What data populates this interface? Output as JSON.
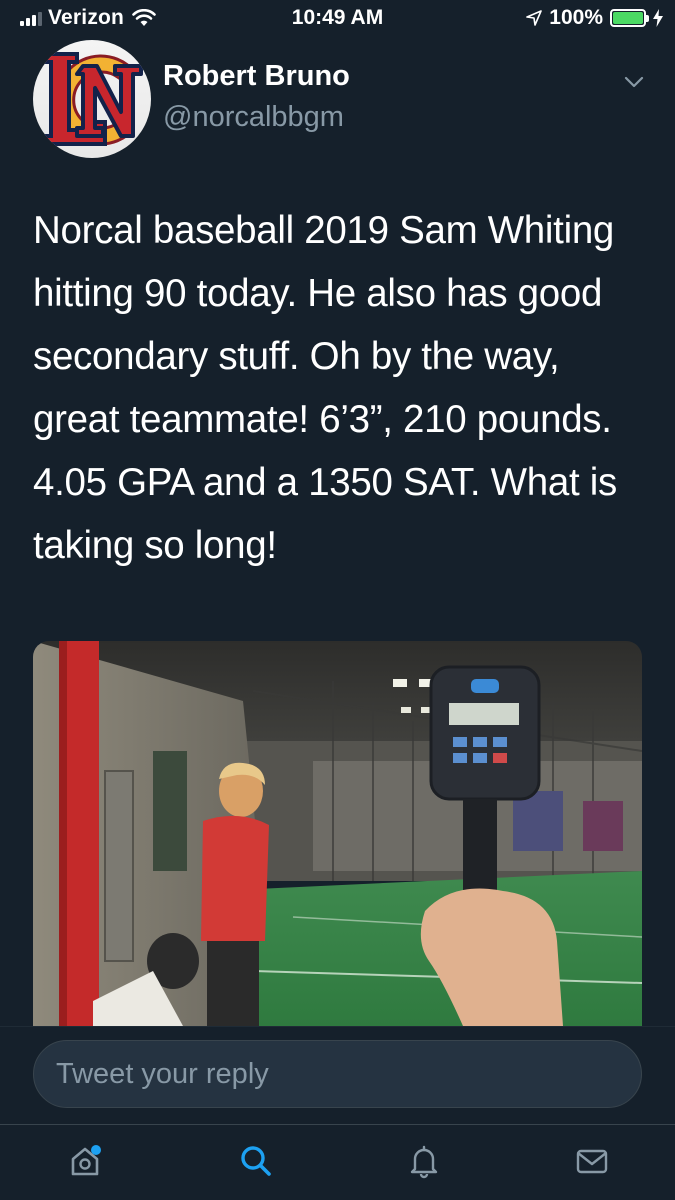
{
  "status_bar": {
    "carrier": "Verizon",
    "time": "10:49 AM",
    "battery_percent": "100%",
    "battery_level": 1.0
  },
  "tweet": {
    "author_name": "Robert Bruno",
    "author_handle": "@norcalbbgm",
    "text": "Norcal baseball 2019 Sam Whiting hitting 90 today. He also has good secondary stuff. Oh by the way, great teammate! 6’3”, 210 pounds. 4.05 GPA and a 1350 SAT. What is taking so long!",
    "avatar_icon": "nc-logo-icon"
  },
  "reply": {
    "placeholder": "Tweet your reply"
  },
  "tab_bar": {
    "items": [
      {
        "icon": "home-icon",
        "active": false,
        "has_badge": true
      },
      {
        "icon": "search-icon",
        "active": true,
        "has_badge": false
      },
      {
        "icon": "notifications-icon",
        "active": false,
        "has_badge": false
      },
      {
        "icon": "messages-icon",
        "active": false,
        "has_badge": false
      }
    ]
  },
  "colors": {
    "background": "#15202b",
    "accent": "#1da1f2",
    "secondary_text": "#8899a6"
  }
}
